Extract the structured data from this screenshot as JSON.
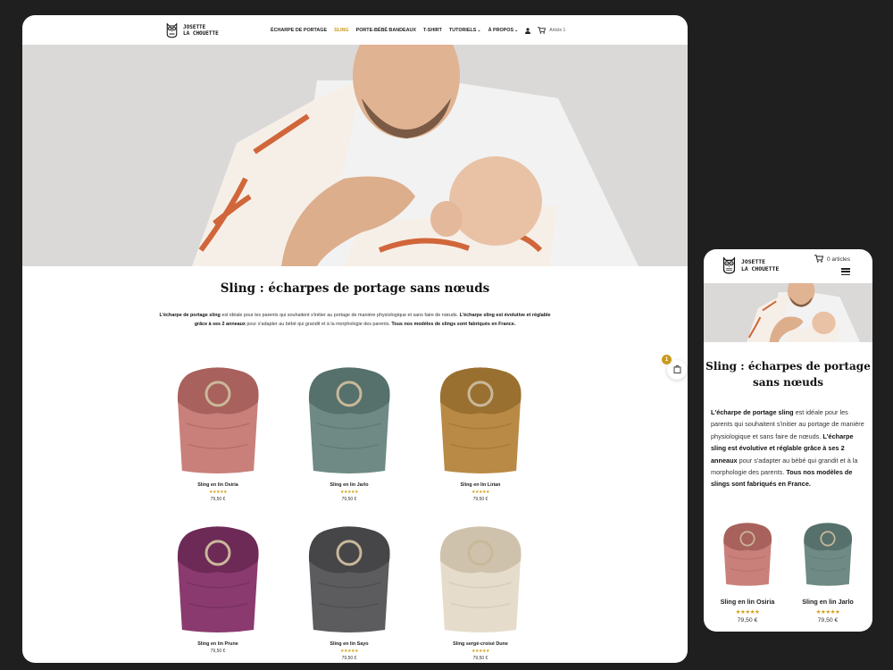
{
  "brand": {
    "line1": "JOSETTE",
    "line2": "LA CHOUETTE"
  },
  "nav": {
    "items": [
      {
        "label": "ÉCHARPE DE PORTAGE",
        "active": false,
        "caret": false
      },
      {
        "label": "SLING",
        "active": true,
        "caret": false
      },
      {
        "label": "PORTE-BÉBÉ BANDEAUX",
        "active": false,
        "caret": false
      },
      {
        "label": "T-SHIRT",
        "active": false,
        "caret": false
      },
      {
        "label": "TUTORIELS",
        "active": false,
        "caret": true
      },
      {
        "label": "À PROPOS",
        "active": false,
        "caret": true
      }
    ],
    "cart_label": "Article 1"
  },
  "page": {
    "title": "Sling : écharpes de portage sans nœuds",
    "mobile_title": "Sling : écharpes de portage sans nœuds",
    "description_parts": [
      {
        "text": "L'écharpe de portage sling",
        "bold": true
      },
      {
        "text": " est idéale pour les parents qui souhaitent s'initier au portage de manière physiologique et sans faire de nœuds. ",
        "bold": false
      },
      {
        "text": "L'écharpe sling est évolutive et réglable grâce à ses 2 anneaux",
        "bold": true
      },
      {
        "text": " pour s'adapter au bébé qui grandit et à la morphologie des parents. ",
        "bold": false
      },
      {
        "text": "Tous nos modèles de slings sont fabriqués en France.",
        "bold": true
      }
    ]
  },
  "products": [
    {
      "name": "Sling en lin Osiria",
      "stars": "★★★★★",
      "price": "79,50 €",
      "old_price": "",
      "color": "#c9807b",
      "dark": "#a8615c"
    },
    {
      "name": "Sling en lin Jarlo",
      "stars": "★★★★★",
      "price": "79,50 €",
      "old_price": "",
      "color": "#6f8a85",
      "dark": "#56706b"
    },
    {
      "name": "Sling en lin Lirian",
      "stars": "★★★★★",
      "price": "79,50 €",
      "old_price": "",
      "color": "#b98a45",
      "dark": "#9a7030"
    },
    {
      "name": "Sling en lin Prune",
      "stars": "",
      "price": "79,50 €",
      "old_price": "",
      "color": "#8a3a6e",
      "dark": "#6e2a57"
    },
    {
      "name": "Sling en lin Sayo",
      "stars": "★★★★★",
      "price": "79,50 €",
      "old_price": "",
      "color": "#5c5c5e",
      "dark": "#464648"
    },
    {
      "name": "Sling sergé-croisé Dune",
      "stars": "★★★★★",
      "price": "79,50 €",
      "old_price": "",
      "color": "#e6dccb",
      "dark": "#cfc2ad"
    }
  ],
  "floating_cart": {
    "count": "1"
  },
  "mobile": {
    "cart_label": "0 articles",
    "products": [
      {
        "name": "Sling en lin Osiria",
        "stars": "★★★★★",
        "price": "79,50 €"
      },
      {
        "name": "Sling en lin Jarlo",
        "stars": "★★★★★",
        "price": "79,50 €"
      }
    ]
  },
  "icons": [
    "owl-logo-icon",
    "user-icon",
    "cart-icon",
    "shopping-bag-icon",
    "hamburger-menu-icon"
  ],
  "colors": {
    "accent": "#c99a1e",
    "background": "#1f1f1f",
    "text": "#111111"
  }
}
